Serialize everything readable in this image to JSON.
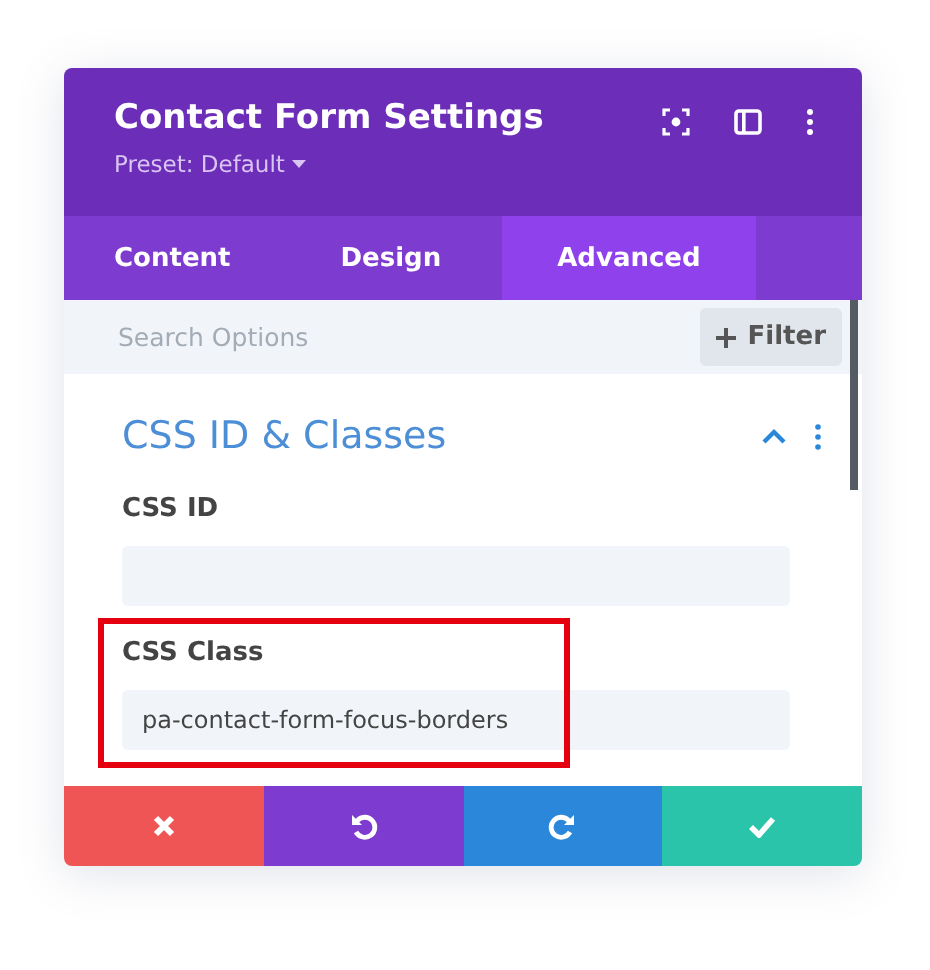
{
  "window": {
    "title": "Contact Form Settings",
    "preset": "Preset: Default"
  },
  "tabs": [
    {
      "label": "Content",
      "selected": false
    },
    {
      "label": "Design",
      "selected": false
    },
    {
      "label": "Advanced",
      "selected": true
    }
  ],
  "search": {
    "placeholder": "Search Options",
    "filter_button": "Filter"
  },
  "section": {
    "title": "CSS ID & Classes",
    "expanded": true
  },
  "fields": [
    {
      "label": "CSS ID",
      "highlighted": false
    },
    {
      "label": "CSS Class",
      "value": "pa-contact-form-focus-borders",
      "highlighted": true
    }
  ],
  "footer": [
    {
      "kind": "cancel"
    },
    {
      "kind": "undo"
    },
    {
      "kind": "redo"
    },
    {
      "kind": "save"
    }
  ]
}
